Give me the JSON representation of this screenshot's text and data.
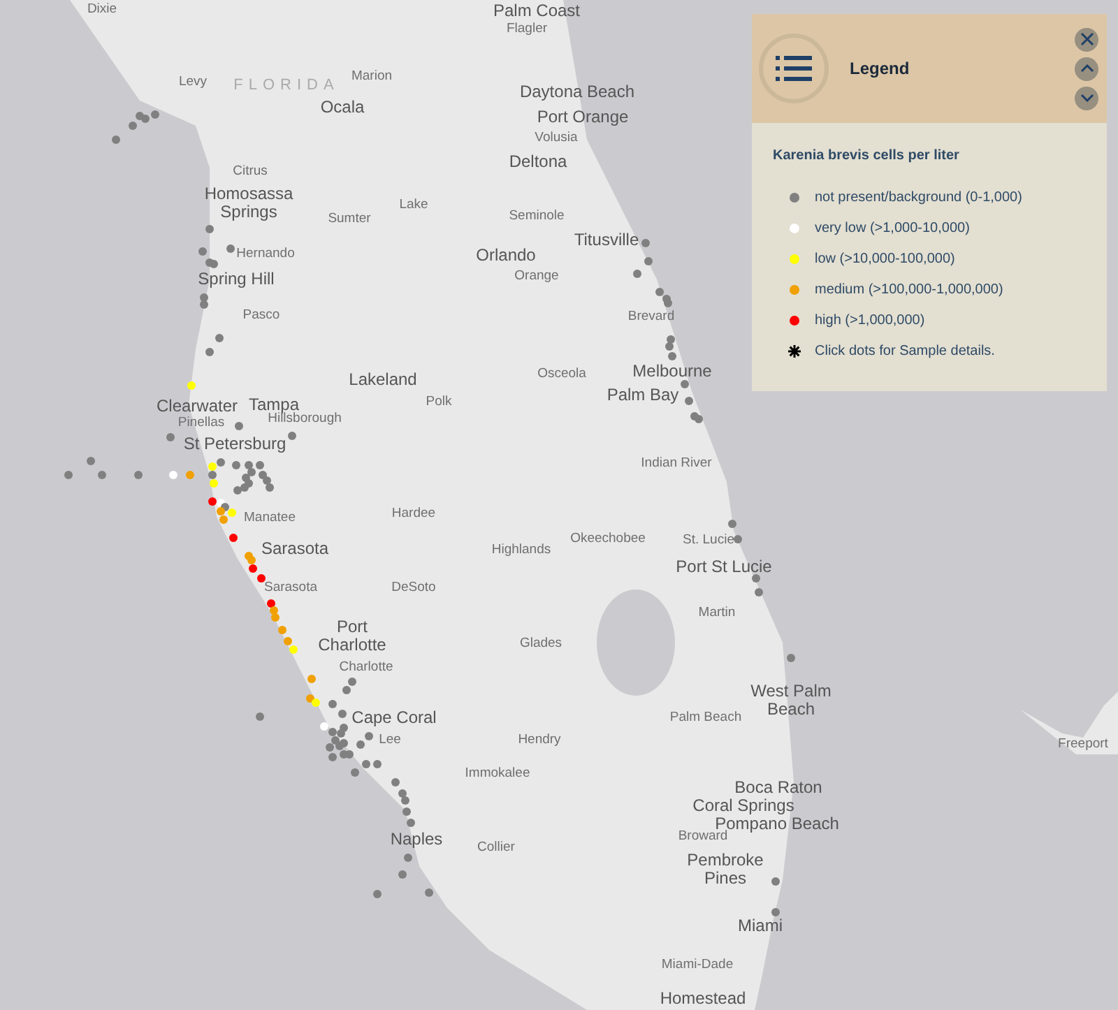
{
  "map": {
    "labels": [
      {
        "text": "Dixie",
        "kind": "county"
      },
      {
        "text": "Palm Coast",
        "kind": "city"
      },
      {
        "text": "Flagler",
        "kind": "county"
      },
      {
        "text": "Levy",
        "kind": "county"
      },
      {
        "text": "FLORIDA",
        "kind": "state"
      },
      {
        "text": "Marion",
        "kind": "county"
      },
      {
        "text": "Ocala",
        "kind": "city"
      },
      {
        "text": "Daytona Beach",
        "kind": "city"
      },
      {
        "text": "Port Orange",
        "kind": "city"
      },
      {
        "text": "Volusia",
        "kind": "county"
      },
      {
        "text": "Deltona",
        "kind": "city"
      },
      {
        "text": "Citrus",
        "kind": "county"
      },
      {
        "text": "Homosassa Springs",
        "kind": "city"
      },
      {
        "text": "Sumter",
        "kind": "county"
      },
      {
        "text": "Lake",
        "kind": "county"
      },
      {
        "text": "Seminole",
        "kind": "county"
      },
      {
        "text": "Titusville",
        "kind": "city"
      },
      {
        "text": "Hernando",
        "kind": "county"
      },
      {
        "text": "Orlando",
        "kind": "city"
      },
      {
        "text": "Orange",
        "kind": "county"
      },
      {
        "text": "Spring Hill",
        "kind": "city"
      },
      {
        "text": "Pasco",
        "kind": "county"
      },
      {
        "text": "Brevard",
        "kind": "county"
      },
      {
        "text": "Lakeland",
        "kind": "city"
      },
      {
        "text": "Osceola",
        "kind": "county"
      },
      {
        "text": "Melbourne",
        "kind": "city"
      },
      {
        "text": "Clearwater",
        "kind": "city"
      },
      {
        "text": "Tampa",
        "kind": "city"
      },
      {
        "text": "Polk",
        "kind": "county"
      },
      {
        "text": "Palm Bay",
        "kind": "city"
      },
      {
        "text": "Pinellas",
        "kind": "county"
      },
      {
        "text": "Hillsborough",
        "kind": "county"
      },
      {
        "text": "St Petersburg",
        "kind": "city"
      },
      {
        "text": "Indian River",
        "kind": "county"
      },
      {
        "text": "Manatee",
        "kind": "county"
      },
      {
        "text": "Hardee",
        "kind": "county"
      },
      {
        "text": "Sarasota",
        "kind": "city"
      },
      {
        "text": "Highlands",
        "kind": "county"
      },
      {
        "text": "Okeechobee",
        "kind": "county"
      },
      {
        "text": "St. Lucie",
        "kind": "county"
      },
      {
        "text": "Port St Lucie",
        "kind": "city"
      },
      {
        "text": "Sarasota",
        "kind": "county"
      },
      {
        "text": "DeSoto",
        "kind": "county"
      },
      {
        "text": "Martin",
        "kind": "county"
      },
      {
        "text": "Port Charlotte",
        "kind": "city"
      },
      {
        "text": "Charlotte",
        "kind": "county"
      },
      {
        "text": "Glades",
        "kind": "county"
      },
      {
        "text": "West Palm Beach",
        "kind": "city"
      },
      {
        "text": "Cape Coral",
        "kind": "city"
      },
      {
        "text": "Lee",
        "kind": "county"
      },
      {
        "text": "Palm Beach",
        "kind": "county"
      },
      {
        "text": "Hendry",
        "kind": "county"
      },
      {
        "text": "Freeport",
        "kind": "county"
      },
      {
        "text": "Immokalee",
        "kind": "county"
      },
      {
        "text": "Boca Raton",
        "kind": "city"
      },
      {
        "text": "Coral Springs",
        "kind": "city"
      },
      {
        "text": "Pompano Beach",
        "kind": "city"
      },
      {
        "text": "Broward",
        "kind": "county"
      },
      {
        "text": "Collier",
        "kind": "county"
      },
      {
        "text": "Naples",
        "kind": "city"
      },
      {
        "text": "Pembroke Pines",
        "kind": "city"
      },
      {
        "text": "Miami",
        "kind": "city"
      },
      {
        "text": "Miami-Dade",
        "kind": "county"
      },
      {
        "text": "Homestead",
        "kind": "city"
      }
    ],
    "samples": [
      {
        "color": "#808080"
      },
      {
        "color": "#808080"
      },
      {
        "color": "#808080"
      },
      {
        "color": "#808080"
      },
      {
        "color": "#808080"
      },
      {
        "color": "#808080"
      },
      {
        "color": "#808080"
      },
      {
        "color": "#808080"
      },
      {
        "color": "#808080"
      },
      {
        "color": "#808080"
      },
      {
        "color": "#808080"
      },
      {
        "color": "#808080"
      },
      {
        "color": "#808080"
      },
      {
        "color": "#808080"
      },
      {
        "color": "#808080"
      },
      {
        "color": "#ffff00"
      },
      {
        "color": "#808080"
      },
      {
        "color": "#808080"
      },
      {
        "color": "#808080"
      },
      {
        "color": "#808080"
      },
      {
        "color": "#808080"
      },
      {
        "color": "#808080"
      },
      {
        "color": "#808080"
      },
      {
        "color": "#808080"
      },
      {
        "color": "#808080"
      },
      {
        "color": "#808080"
      },
      {
        "color": "#808080"
      },
      {
        "color": "#808080"
      },
      {
        "color": "#808080"
      },
      {
        "color": "#808080"
      },
      {
        "color": "#808080"
      },
      {
        "color": "#808080"
      },
      {
        "color": "#808080"
      },
      {
        "color": "#808080"
      },
      {
        "color": "#ffffff"
      },
      {
        "color": "#f0a000"
      },
      {
        "color": "#ffff00"
      },
      {
        "color": "#808080"
      },
      {
        "color": "#ffff00"
      },
      {
        "color": "#ff0000"
      },
      {
        "color": "#ffffff"
      },
      {
        "color": "#808080"
      },
      {
        "color": "#ffff00"
      },
      {
        "color": "#f0a000"
      },
      {
        "color": "#f0a000"
      },
      {
        "color": "#ff0000"
      },
      {
        "color": "#f0a000"
      },
      {
        "color": "#f0a000"
      },
      {
        "color": "#ff0000"
      },
      {
        "color": "#ff0000"
      },
      {
        "color": "#ff0000"
      },
      {
        "color": "#f0a000"
      },
      {
        "color": "#f0a000"
      },
      {
        "color": "#f0a000"
      },
      {
        "color": "#f0a000"
      },
      {
        "color": "#ffff00"
      },
      {
        "color": "#f0a000"
      },
      {
        "color": "#f0a000"
      },
      {
        "color": "#ffff00"
      },
      {
        "color": "#808080"
      },
      {
        "color": "#808080"
      },
      {
        "color": "#808080"
      },
      {
        "color": "#808080"
      },
      {
        "color": "#808080"
      },
      {
        "color": "#808080"
      },
      {
        "color": "#ffffff"
      },
      {
        "color": "#808080"
      },
      {
        "color": "#808080"
      },
      {
        "color": "#808080"
      },
      {
        "color": "#808080"
      },
      {
        "color": "#808080"
      },
      {
        "color": "#808080"
      },
      {
        "color": "#808080"
      },
      {
        "color": "#808080"
      },
      {
        "color": "#808080"
      },
      {
        "color": "#808080"
      },
      {
        "color": "#808080"
      },
      {
        "color": "#808080"
      },
      {
        "color": "#808080"
      },
      {
        "color": "#808080"
      },
      {
        "color": "#808080"
      },
      {
        "color": "#808080"
      },
      {
        "color": "#808080"
      },
      {
        "color": "#808080"
      },
      {
        "color": "#808080"
      },
      {
        "color": "#808080"
      },
      {
        "color": "#808080"
      },
      {
        "color": "#808080"
      },
      {
        "color": "#808080"
      },
      {
        "color": "#808080"
      },
      {
        "color": "#808080"
      },
      {
        "color": "#808080"
      },
      {
        "color": "#808080"
      },
      {
        "color": "#808080"
      },
      {
        "color": "#808080"
      },
      {
        "color": "#808080"
      },
      {
        "color": "#808080"
      },
      {
        "color": "#808080"
      },
      {
        "color": "#808080"
      },
      {
        "color": "#808080"
      },
      {
        "color": "#808080"
      },
      {
        "color": "#808080"
      },
      {
        "color": "#808080"
      },
      {
        "color": "#808080"
      },
      {
        "color": "#808080"
      },
      {
        "color": "#808080"
      },
      {
        "color": "#808080"
      },
      {
        "color": "#808080"
      },
      {
        "color": "#808080"
      }
    ]
  },
  "legend": {
    "title": "Legend",
    "subtitle": "Karenia brevis cells per liter",
    "items": [
      {
        "kind": "swatch",
        "label": "not present/background (0-1,000)",
        "color": "#808080"
      },
      {
        "kind": "swatch",
        "label": "very low (>1,000-10,000)",
        "color": "#ffffff"
      },
      {
        "kind": "swatch",
        "label": "low (>10,000-100,000)",
        "color": "#ffff00"
      },
      {
        "kind": "swatch",
        "label": "medium (>100,000-1,000,000)",
        "color": "#f0a000"
      },
      {
        "kind": "swatch",
        "label": "high (>1,000,000)",
        "color": "#ff0000"
      },
      {
        "kind": "hint",
        "label": "Click dots for Sample details."
      }
    ]
  }
}
